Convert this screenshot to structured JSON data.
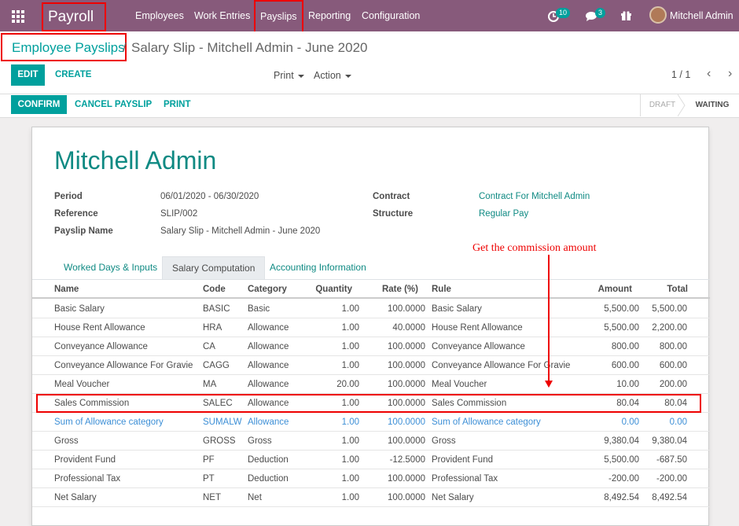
{
  "topbar": {
    "app_title": "Payroll",
    "menu": [
      "Employees",
      "Work Entries",
      "Payslips",
      "Reporting",
      "Configuration"
    ],
    "activity_count": "10",
    "message_count": "3",
    "user_name": "Mitchell Admin"
  },
  "breadcrumb": {
    "parent": "Employee Payslips",
    "separator": "/",
    "current": "Salary Slip - Mitchell Admin - June 2020"
  },
  "buttons": {
    "edit": "EDIT",
    "create": "CREATE",
    "print_dd": "Print",
    "action_dd": "Action",
    "confirm": "CONFIRM",
    "cancel_payslip": "CANCEL PAYSLIP",
    "print": "PRINT"
  },
  "pager": "1 / 1",
  "stages": [
    "DRAFT",
    "WAITING"
  ],
  "form": {
    "employee_name": "Mitchell Admin",
    "fields": {
      "period_label": "Period",
      "period_value": "06/01/2020 - 06/30/2020",
      "reference_label": "Reference",
      "reference_value": "SLIP/002",
      "payslip_name_label": "Payslip Name",
      "payslip_name_value": "Salary Slip - Mitchell Admin - June 2020",
      "contract_label": "Contract",
      "contract_value": "Contract For Mitchell Admin",
      "structure_label": "Structure",
      "structure_value": "Regular Pay"
    },
    "tabs": [
      "Worked Days & Inputs",
      "Salary Computation",
      "Accounting Information"
    ],
    "annotation": "Get the commission amount"
  },
  "table": {
    "headers": [
      "Name",
      "Code",
      "Category",
      "Quantity",
      "Rate (%)",
      "Rule",
      "Amount",
      "Total"
    ],
    "rows": [
      [
        "Basic Salary",
        "BASIC",
        "Basic",
        "1.00",
        "100.0000",
        "Basic Salary",
        "5,500.00",
        "5,500.00"
      ],
      [
        "House Rent Allowance",
        "HRA",
        "Allowance",
        "1.00",
        "40.0000",
        "House Rent Allowance",
        "5,500.00",
        "2,200.00"
      ],
      [
        "Conveyance Allowance",
        "CA",
        "Allowance",
        "1.00",
        "100.0000",
        "Conveyance Allowance",
        "800.00",
        "800.00"
      ],
      [
        "Conveyance Allowance For Gravie",
        "CAGG",
        "Allowance",
        "1.00",
        "100.0000",
        "Conveyance Allowance For Gravie",
        "600.00",
        "600.00"
      ],
      [
        "Meal Voucher",
        "MA",
        "Allowance",
        "20.00",
        "100.0000",
        "Meal Voucher",
        "10.00",
        "200.00"
      ],
      [
        "Sales Commission",
        "SALEC",
        "Allowance",
        "1.00",
        "100.0000",
        "Sales Commission",
        "80.04",
        "80.04"
      ],
      [
        "Sum of Allowance category",
        "SUMALW",
        "Allowance",
        "1.00",
        "100.0000",
        "Sum of Allowance category",
        "0.00",
        "0.00"
      ],
      [
        "Gross",
        "GROSS",
        "Gross",
        "1.00",
        "100.0000",
        "Gross",
        "9,380.04",
        "9,380.04"
      ],
      [
        "Provident Fund",
        "PF",
        "Deduction",
        "1.00",
        "-12.5000",
        "Provident Fund",
        "5,500.00",
        "-687.50"
      ],
      [
        "Professional Tax",
        "PT",
        "Deduction",
        "1.00",
        "100.0000",
        "Professional Tax",
        "-200.00",
        "-200.00"
      ],
      [
        "Net Salary",
        "NET",
        "Net",
        "1.00",
        "100.0000",
        "Net Salary",
        "8,492.54",
        "8,492.54"
      ]
    ]
  }
}
